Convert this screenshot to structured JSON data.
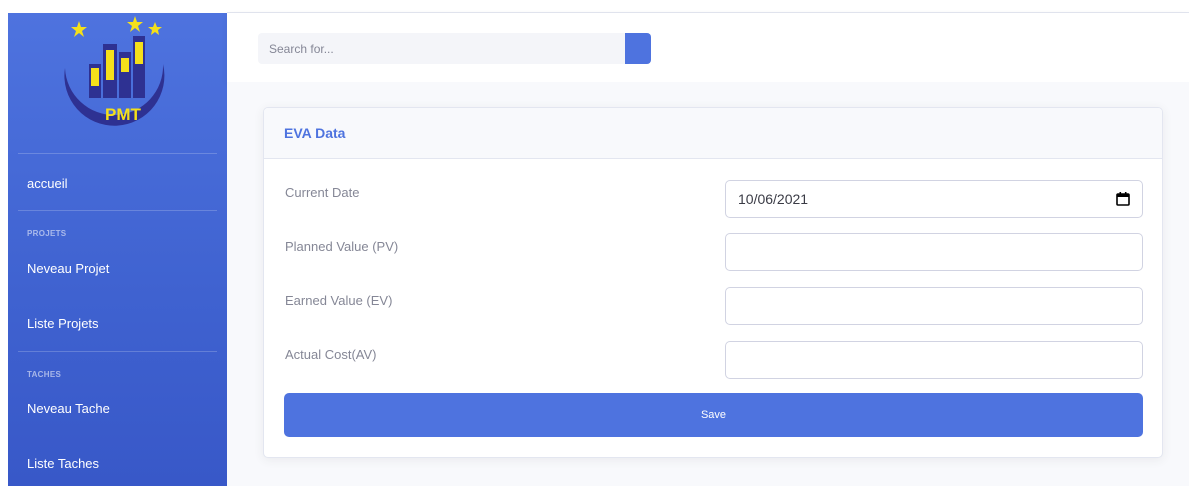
{
  "sidebar": {
    "brand_initials": "PMT",
    "items": [
      {
        "label": "accueil"
      },
      {
        "label": "Neveau Projet"
      },
      {
        "label": "Liste Projets"
      },
      {
        "label": "Neveau Tache"
      },
      {
        "label": "Liste Taches"
      }
    ],
    "headings": [
      "PROJETS",
      "TACHES"
    ]
  },
  "search": {
    "placeholder": "Search for..."
  },
  "card": {
    "title": "EVA Data",
    "fields": [
      {
        "label": "Current Date",
        "value": "10/06/2021",
        "icon": "calendar-icon"
      },
      {
        "label": "Planned Value (PV)",
        "value": ""
      },
      {
        "label": "Earned Value (EV)",
        "value": ""
      },
      {
        "label": "Actual Cost(AV)",
        "value": ""
      }
    ],
    "save_label": "Save"
  },
  "colors": {
    "primary": "#4e73df",
    "logo_navy": "#2e3192",
    "logo_yellow": "#f5e01a"
  }
}
